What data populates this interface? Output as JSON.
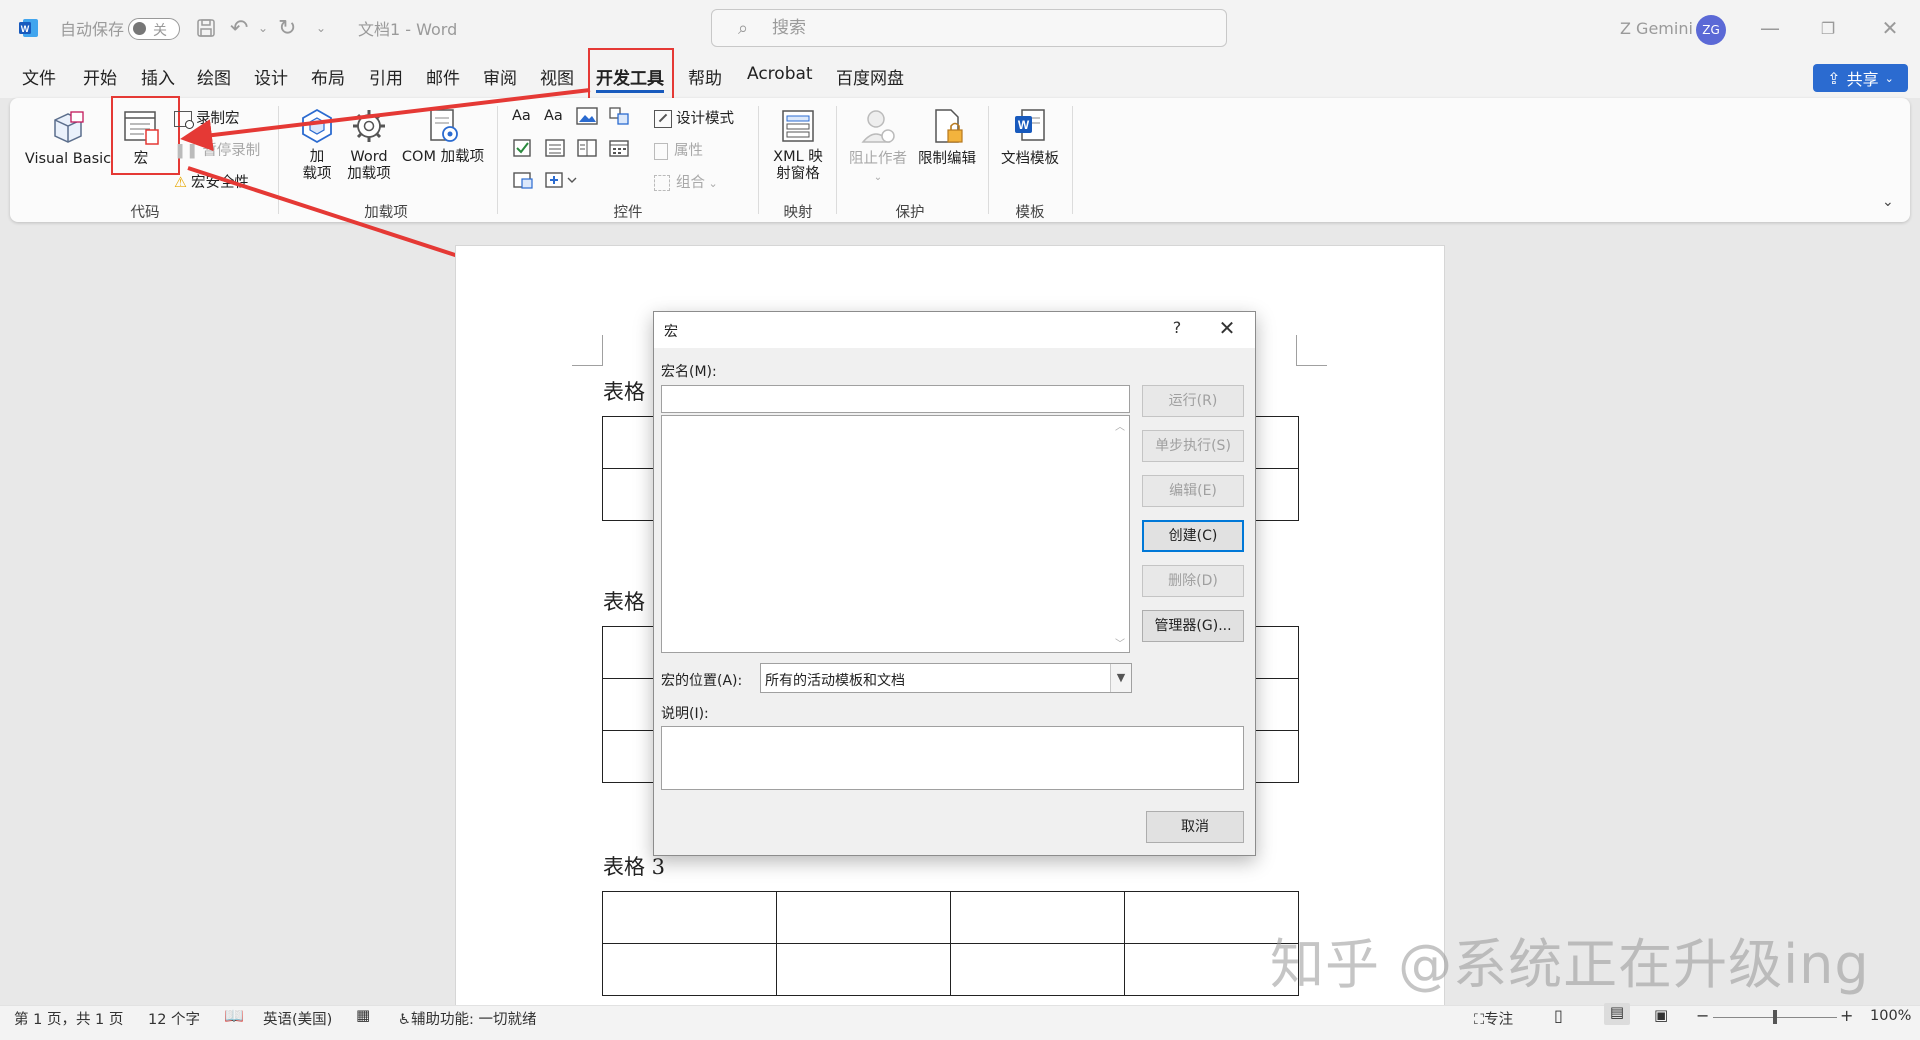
{
  "titlebar": {
    "autosave_label": "自动保存",
    "autosave_state": "关",
    "doc_title": "文档1  -  Word",
    "search_placeholder": "搜索",
    "user_name": "Z Gemini",
    "user_initials": "ZG"
  },
  "menu": {
    "tabs": [
      {
        "label": "文件"
      },
      {
        "label": "开始"
      },
      {
        "label": "插入"
      },
      {
        "label": "绘图"
      },
      {
        "label": "设计"
      },
      {
        "label": "布局"
      },
      {
        "label": "引用"
      },
      {
        "label": "邮件"
      },
      {
        "label": "审阅"
      },
      {
        "label": "视图"
      },
      {
        "label": "开发工具"
      },
      {
        "label": "帮助"
      },
      {
        "label": "Acrobat"
      },
      {
        "label": "百度网盘"
      }
    ],
    "active_tab": "开发工具",
    "share_label": "共享"
  },
  "ribbon": {
    "code": {
      "group_label": "代码",
      "visual_basic": "Visual Basic",
      "macros": "宏",
      "record_macro": "录制宏",
      "pause_recording": "暂停录制",
      "macro_security": "宏安全性"
    },
    "addins": {
      "group_label": "加载项",
      "addins_line1": "加",
      "addins_line2": "载项",
      "word_addins_line1": "Word",
      "word_addins_line2": "加载项",
      "com_addins": "COM 加载项"
    },
    "controls": {
      "group_label": "控件",
      "design_mode": "设计模式",
      "properties": "属性",
      "group": "组合"
    },
    "mapping": {
      "group_label": "映射",
      "xml_line1": "XML 映",
      "xml_line2": "射窗格"
    },
    "protect": {
      "group_label": "保护",
      "block_authors": "阻止作者",
      "restrict_editing": "限制编辑"
    },
    "templates": {
      "group_label": "模板",
      "document_template": "文档模板"
    }
  },
  "document": {
    "table1_caption": "表格",
    "table2_caption": "表格",
    "table3_caption": "表格 3"
  },
  "dialog": {
    "title": "宏",
    "help": "?",
    "macro_name_label": "宏名(M):",
    "macro_name_value": "",
    "buttons": {
      "run": "运行(R)",
      "step_into": "单步执行(S)",
      "edit": "编辑(E)",
      "create": "创建(C)",
      "delete": "删除(D)",
      "organizer": "管理器(G)...",
      "cancel": "取消"
    },
    "macros_in_label": "宏的位置(A):",
    "macros_in_value": "所有的活动模板和文档",
    "description_label": "说明(I):",
    "description_value": ""
  },
  "statusbar": {
    "page": "第 1 页，共 1 页",
    "word_count": "12 个字",
    "language": "英语(美国)",
    "accessibility": "辅助功能: 一切就绪",
    "focus": "专注",
    "zoom": "100%"
  },
  "watermark": "知乎 @系统正在升级ing",
  "colors": {
    "accent": "#185abd",
    "share_button": "#2b6bd0",
    "highlight_red": "#e53935",
    "avatar": "#5b69d6"
  }
}
